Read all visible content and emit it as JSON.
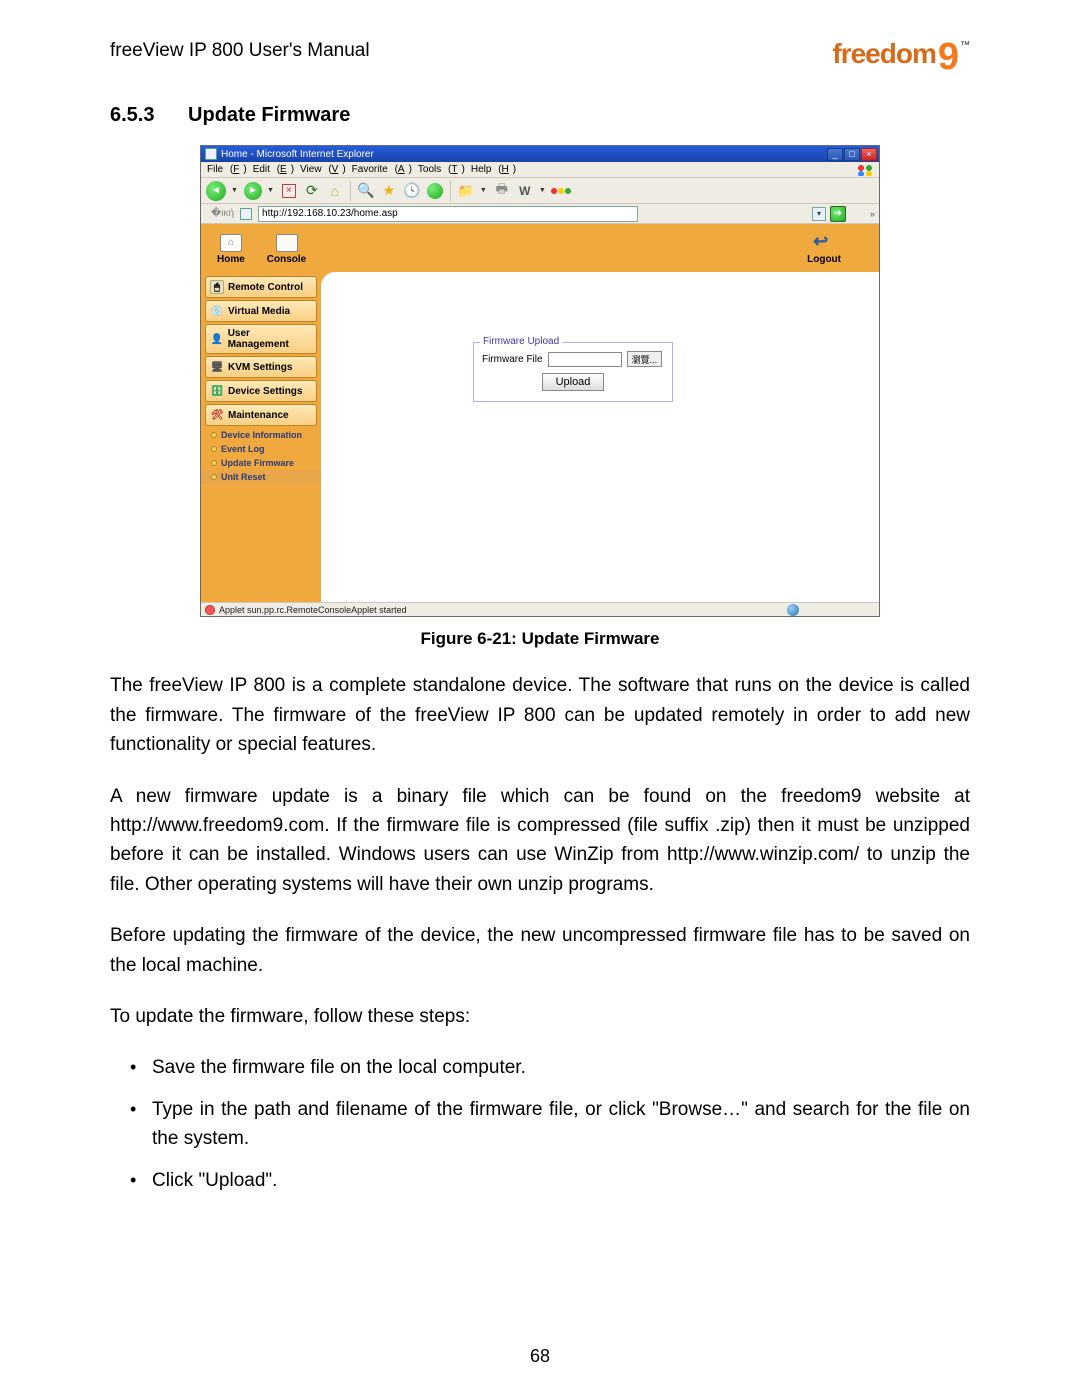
{
  "header": {
    "title": "freeView IP 800 User's Manual",
    "logo_word": "freedom",
    "logo_digit": "9",
    "logo_tm": "™"
  },
  "section": {
    "number": "6.5.3",
    "title": "Update Firmware"
  },
  "screenshot": {
    "window_title": "Home - Microsoft Internet Explorer",
    "menu": {
      "file": "File",
      "edit": "Edit",
      "view": "View",
      "favorite": "Favorite",
      "tools": "Tools",
      "help": "Help",
      "file_k": "F",
      "edit_k": "E",
      "view_k": "V",
      "favorite_k": "A",
      "tools_k": "T",
      "help_k": "H"
    },
    "address_url": "http://192.168.10.23/home.asp",
    "nav": {
      "home": "Home",
      "console": "Console",
      "logout": "Logout"
    },
    "sidebar": {
      "remote_control": "Remote Control",
      "virtual_media": "Virtual Media",
      "user_management": "User Management",
      "kvm_settings": "KVM Settings",
      "device_settings": "Device Settings",
      "maintenance": "Maintenance",
      "sub": {
        "device_info": "Device Information",
        "event_log": "Event Log",
        "update_firmware": "Update Firmware",
        "unit_reset": "Unit Reset"
      }
    },
    "firmware": {
      "legend": "Firmware Upload",
      "file_label": "Firmware File",
      "browse": "瀏覽...",
      "upload": "Upload"
    },
    "status_text": "Applet sun.pp.rc.RemoteConsoleApplet started"
  },
  "figure_caption": "Figure 6-21: Update Firmware",
  "paragraphs": {
    "p1": "The freeView IP 800 is a complete standalone device. The software that runs on the device is called the firmware. The firmware of the freeView IP 800 can be updated remotely in order to add new functionality or special features.",
    "p2": "A new firmware update is a binary file which can be found on the freedom9 website at http://www.freedom9.com. If the firmware file is compressed (file suffix .zip) then it must be unzipped before it can be installed. Windows users can use WinZip from http://www.winzip.com/ to unzip the file. Other operating systems will have their own unzip programs.",
    "p3": "Before updating the firmware of the device, the new uncompressed firmware file has to be saved on the local machine.",
    "p4": "To update the firmware, follow these steps:"
  },
  "bullets": {
    "b1": "Save the firmware file on the local computer.",
    "b2": "Type in the path and filename of the firmware file, or click \"Browse…\" and search for the file on the system.",
    "b3": "Click \"Upload\"."
  },
  "page_number": "68"
}
